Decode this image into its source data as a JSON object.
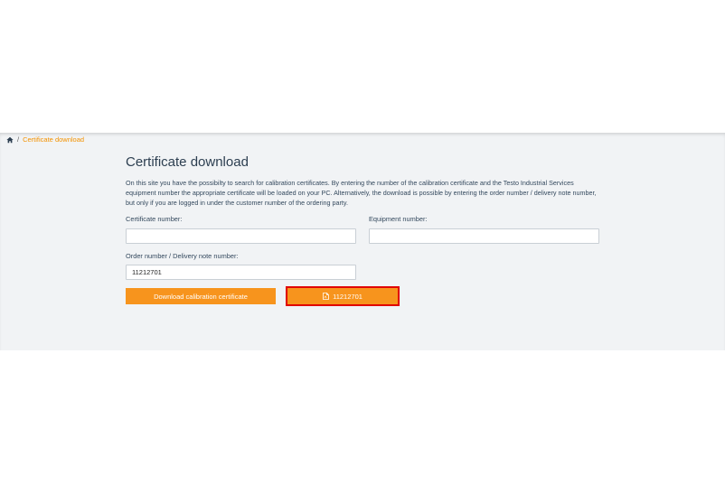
{
  "breadcrumb": {
    "home_icon": "home-icon",
    "separator": "/",
    "current": "Certificate download"
  },
  "page": {
    "title": "Certificate download",
    "intro": "On this site you have the possibilty to search for calibration certificates. By entering the number of the calibration certificate and the Testo Industrial Services equipment number the appropriate certificate will be loaded on your PC. Alternatively, the download is possible by entering the order number / delivery note number, but only if you are logged in under the customer number of the ordering party."
  },
  "form": {
    "certificate_label": "Certificate number:",
    "certificate_value": "",
    "equipment_label": "Equipment number:",
    "equipment_value": "",
    "order_label": "Order number / Delivery note number:",
    "order_value": "11212701"
  },
  "buttons": {
    "download_label": "Download calibration certificate",
    "result_label": "11212701",
    "result_icon": "pdf-file-icon"
  },
  "colors": {
    "accent": "#f7941d",
    "link": "#f39200",
    "panel_bg": "#f1f3f5",
    "highlight_border": "#e00000"
  }
}
